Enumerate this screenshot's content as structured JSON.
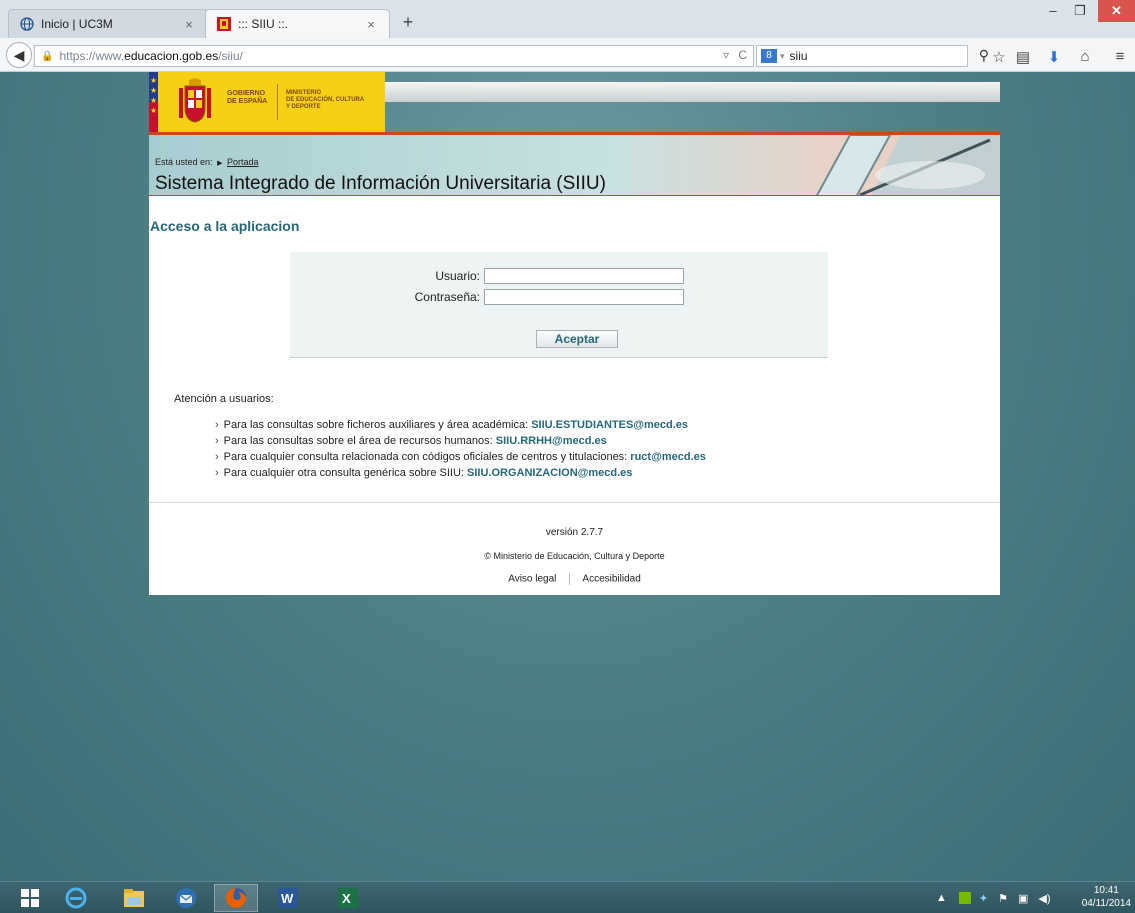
{
  "browser": {
    "tabs": [
      {
        "title": "Inicio | UC3M",
        "icon": "globe-icon"
      },
      {
        "title": "::: SIIU ::.",
        "icon": "spain-shield-icon"
      }
    ],
    "new_tab": "+",
    "url": {
      "prefix": "https://www.",
      "host": "educacion.gob.es",
      "path": "/siiu/"
    },
    "search_text": "siiu",
    "window_controls": {
      "minimize": "–",
      "restore": "❐",
      "close": "✕"
    }
  },
  "header": {
    "gov_text": "GOBIERNO\nDE ESPAÑA",
    "ministry_text": "MINISTERIO\nDE EDUCACIÓN, CULTURA\nY DEPORTE",
    "breadcrumb_prefix": "Está usted en:",
    "breadcrumb_link": "Portada",
    "system_title": "Sistema Integrado de Información Universitaria (SIIU)"
  },
  "login": {
    "title": "Acceso a la aplicacion",
    "user_label": "Usuario:",
    "user_value": "",
    "password_label": "Contraseña:",
    "password_value": "",
    "submit_label": "Aceptar"
  },
  "support": {
    "heading": "Atención a usuarios:",
    "items": [
      {
        "text": "Para las consultas sobre ficheros auxiliares y área académica: ",
        "email": "SIIU.ESTUDIANTES@mecd.es"
      },
      {
        "text": "Para las consultas sobre el área de recursos humanos: ",
        "email": "SIIU.RRHH@mecd.es"
      },
      {
        "text": "Para cualquier consulta relacionada con códigos oficiales de centros y titulaciones: ",
        "email": "ruct@mecd.es"
      },
      {
        "text": "Para cualquier otra consulta genérica sobre SIIU: ",
        "email": "SIIU.ORGANIZACION@mecd.es"
      }
    ]
  },
  "footer": {
    "version": "versión 2.7.7",
    "copyright": "© Ministerio de Educación, Cultura y Deporte",
    "links": [
      "Aviso legal",
      "Accesibilidad"
    ]
  },
  "taskbar": {
    "apps": [
      "windows-start-icon",
      "internet-explorer-icon",
      "file-explorer-icon",
      "thunderbird-icon",
      "firefox-icon",
      "word-icon",
      "excel-icon"
    ],
    "clock_time": "10:41",
    "clock_date": "04/11/2014"
  },
  "colors": {
    "accent_teal": "#24687a",
    "banner_red": "#d0451b",
    "gov_yellow": "#f7cf14",
    "desktop_bg": "#4f8086"
  }
}
